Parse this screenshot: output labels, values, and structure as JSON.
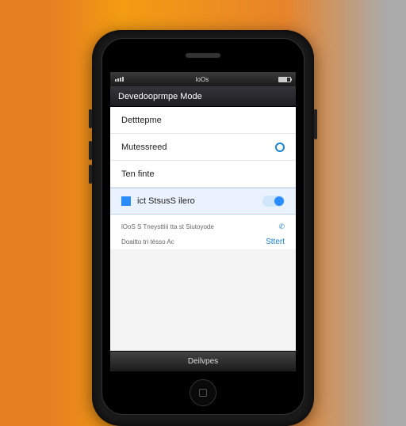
{
  "status": {
    "carrier_label": "",
    "title": "loOs"
  },
  "nav": {
    "title": "Devedooprmpe Mode"
  },
  "rows": [
    {
      "label": "Detttepme"
    },
    {
      "label": "Mutessreed"
    },
    {
      "label": "Ten finte"
    },
    {
      "label": "ict StsusS ilero"
    }
  ],
  "small": [
    {
      "label": "lOoS S Tneysttìii tta st Siutoyode"
    },
    {
      "label": "Doaitto tri tésso  Ac",
      "action": "Sttert"
    }
  ],
  "bottom": {
    "label": "Deilvpes"
  }
}
